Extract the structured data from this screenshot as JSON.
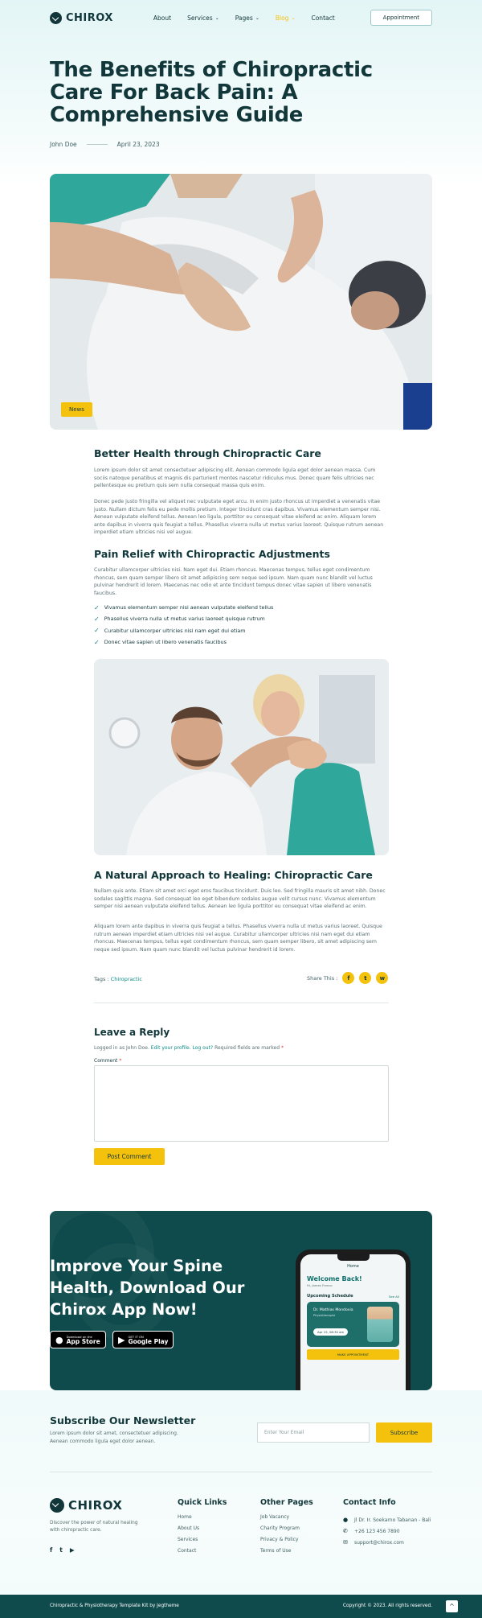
{
  "header": {
    "logo_text": "CHIROX",
    "nav": [
      {
        "label": "About",
        "has_dropdown": false
      },
      {
        "label": "Services",
        "has_dropdown": true
      },
      {
        "label": "Pages",
        "has_dropdown": true
      },
      {
        "label": "Blog",
        "has_dropdown": true,
        "active": true
      },
      {
        "label": "Contact",
        "has_dropdown": false
      }
    ],
    "appointment_label": "Appointment"
  },
  "post": {
    "title": "The Benefits of Chiropractic Care For Back Pain: A Comprehensive Guide",
    "author": "John Doe",
    "date": "April 23, 2023",
    "hero_badge": "News",
    "section1_title": "Better Health through Chiropractic Care",
    "section1_p1": "Lorem ipsum dolor sit amet consectetuer adipiscing elit. Aenean commodo ligula eget dolor aenean massa. Cum sociis natoque penatibus et magnis dis parturient montes nascetur ridiculus mus. Donec quam felis ultricies nec pellentesque eu pretium quis sem nulla consequat massa quis enim.",
    "section1_p2": "Donec pede justo fringilla vel aliquet nec vulputate eget arcu. In enim justo rhoncus ut imperdiet a venenatis vitae justo. Nullam dictum felis eu pede mollis pretium. Integer tincidunt cras dapibus. Vivamus elementum semper nisi. Aenean vulputate eleifend tellus. Aenean leo ligula, porttitor eu consequat vitae eleifend ac enim. Aliquam lorem ante dapibus in viverra quis feugiat a tellus. Phasellus viverra nulla ut metus varius laoreet. Quisque rutrum aenean imperdiet etiam ultricies nisi vel augue.",
    "section2_title": "Pain Relief with Chiropractic Adjustments",
    "section2_p1": "Curabitur ullamcorper ultricies nisi. Nam eget dui. Etiam rhoncus. Maecenas tempus, tellus eget condimentum rhoncus, sem quam semper libero sit amet adipiscing sem neque sed ipsum. Nam quam nunc blandit vel luctus pulvinar hendrerit id lorem. Maecenas nec odio et ante tincidunt tempus donec vitae sapien ut libero venenatis faucibus.",
    "checklist": [
      "Vivamus elementum semper nisi aenean vulputate eleifend tellus",
      "Phasellus viverra nulla ut metus varius laoreet quisque rutrum",
      "Curabitur ullamcorper ultricies nisi nam eget dui etiam",
      "Donec vitae sapien ut libero venenatis faucibus"
    ],
    "section3_title": "A Natural Approach to Healing: Chiropractic Care",
    "section3_p1": "Nullam quis ante. Etiam sit amet orci eget eros faucibus tincidunt. Duis leo. Sed fringilla mauris sit amet nibh. Donec sodales sagittis magna. Sed consequat leo eget bibendum sodales augue velit cursus nunc. Vivamus elementum semper nisi aenean vulputate eleifend tellus. Aenean leo ligula porttitor eu consequat vitae eleifend ac enim.",
    "section3_p2": "Aliquam lorem ante dapibus in viverra quis feugiat a tellus. Phasellus viverra nulla ut metus varius laoreet. Quisque rutrum aenean imperdiet etiam ultricies nisi vel augue. Curabitur ullamcorper ultricies nisi nam eget dui etiam rhoncus. Maecenas tempus, tellus eget condimentum rhoncus, sem quam semper libero, sit amet adipiscing sem neque sed ipsum. Nam quam nunc blandit vel luctus pulvinar hendrerit id lorem.",
    "tags_label": "Tags :",
    "tag": "Chiropractic",
    "share_label": "Share This :",
    "share_icons": [
      "f",
      "t",
      "w"
    ]
  },
  "reply": {
    "title": "Leave a Reply",
    "logged_prefix": "Logged in as John Doe.",
    "edit_profile": "Edit your profile.",
    "logout": "Log out?",
    "required_note": "Required fields are marked",
    "required_mark": "*",
    "comment_label": "Comment",
    "post_button": "Post Comment"
  },
  "app_banner": {
    "title": "Improve Your Spine Health, Download Our Chirox App Now!",
    "appstore_small": "Download on the",
    "appstore_big": "App Store",
    "playstore_small": "GET IT ON",
    "playstore_big": "Google Play",
    "phone": {
      "home": "Home",
      "welcome": "Welcome Back!",
      "user": "Hi, James Franco",
      "schedule": "Upcoming Schedule",
      "see_all": "See All",
      "doctor": "Dr. Mathias Mondovia",
      "role": "Physiotherapist",
      "date": "Apr 15, 08:30 am",
      "button": "MAKE APPOINTMENT"
    }
  },
  "newsletter": {
    "title": "Subscribe Our Newsletter",
    "desc": "Lorem ipsum dolor sit amet, consectetuer adipiscing. Aenean commodo ligula eget dolor aenean.",
    "placeholder": "Enter Your Email",
    "button": "Subscribe"
  },
  "footer": {
    "logo_text": "CHIROX",
    "desc": "Discover the power of natural healing with chiropractic care.",
    "social": [
      "f",
      "t",
      "▶"
    ],
    "quick_links_title": "Quick Links",
    "quick_links": [
      "Home",
      "About Us",
      "Services",
      "Contact"
    ],
    "other_pages_title": "Other Pages",
    "other_pages": [
      "Job Vacancy",
      "Charity Program",
      "Privacy & Policy",
      "Terms of Use"
    ],
    "contact_title": "Contact Info",
    "contact": [
      {
        "icon": "location-icon",
        "glyph": "●",
        "text": "Jl Dr. Ir. Soekarno Tabanan - Bali"
      },
      {
        "icon": "phone-icon",
        "glyph": "✆",
        "text": "+26 123 456 7890"
      },
      {
        "icon": "mail-icon",
        "glyph": "✉",
        "text": "support@chirox.com"
      }
    ],
    "copyright_left": "Chiropractic & Physiotherapy Template Kit by Jegtheme",
    "copyright_right": "Copyright © 2023. All rights reserved.",
    "totop_glyph": "^"
  },
  "colors": {
    "accent": "#f4c20d",
    "brand": "#0f4b4c",
    "text": "#12373a",
    "link": "#0c8b86"
  }
}
